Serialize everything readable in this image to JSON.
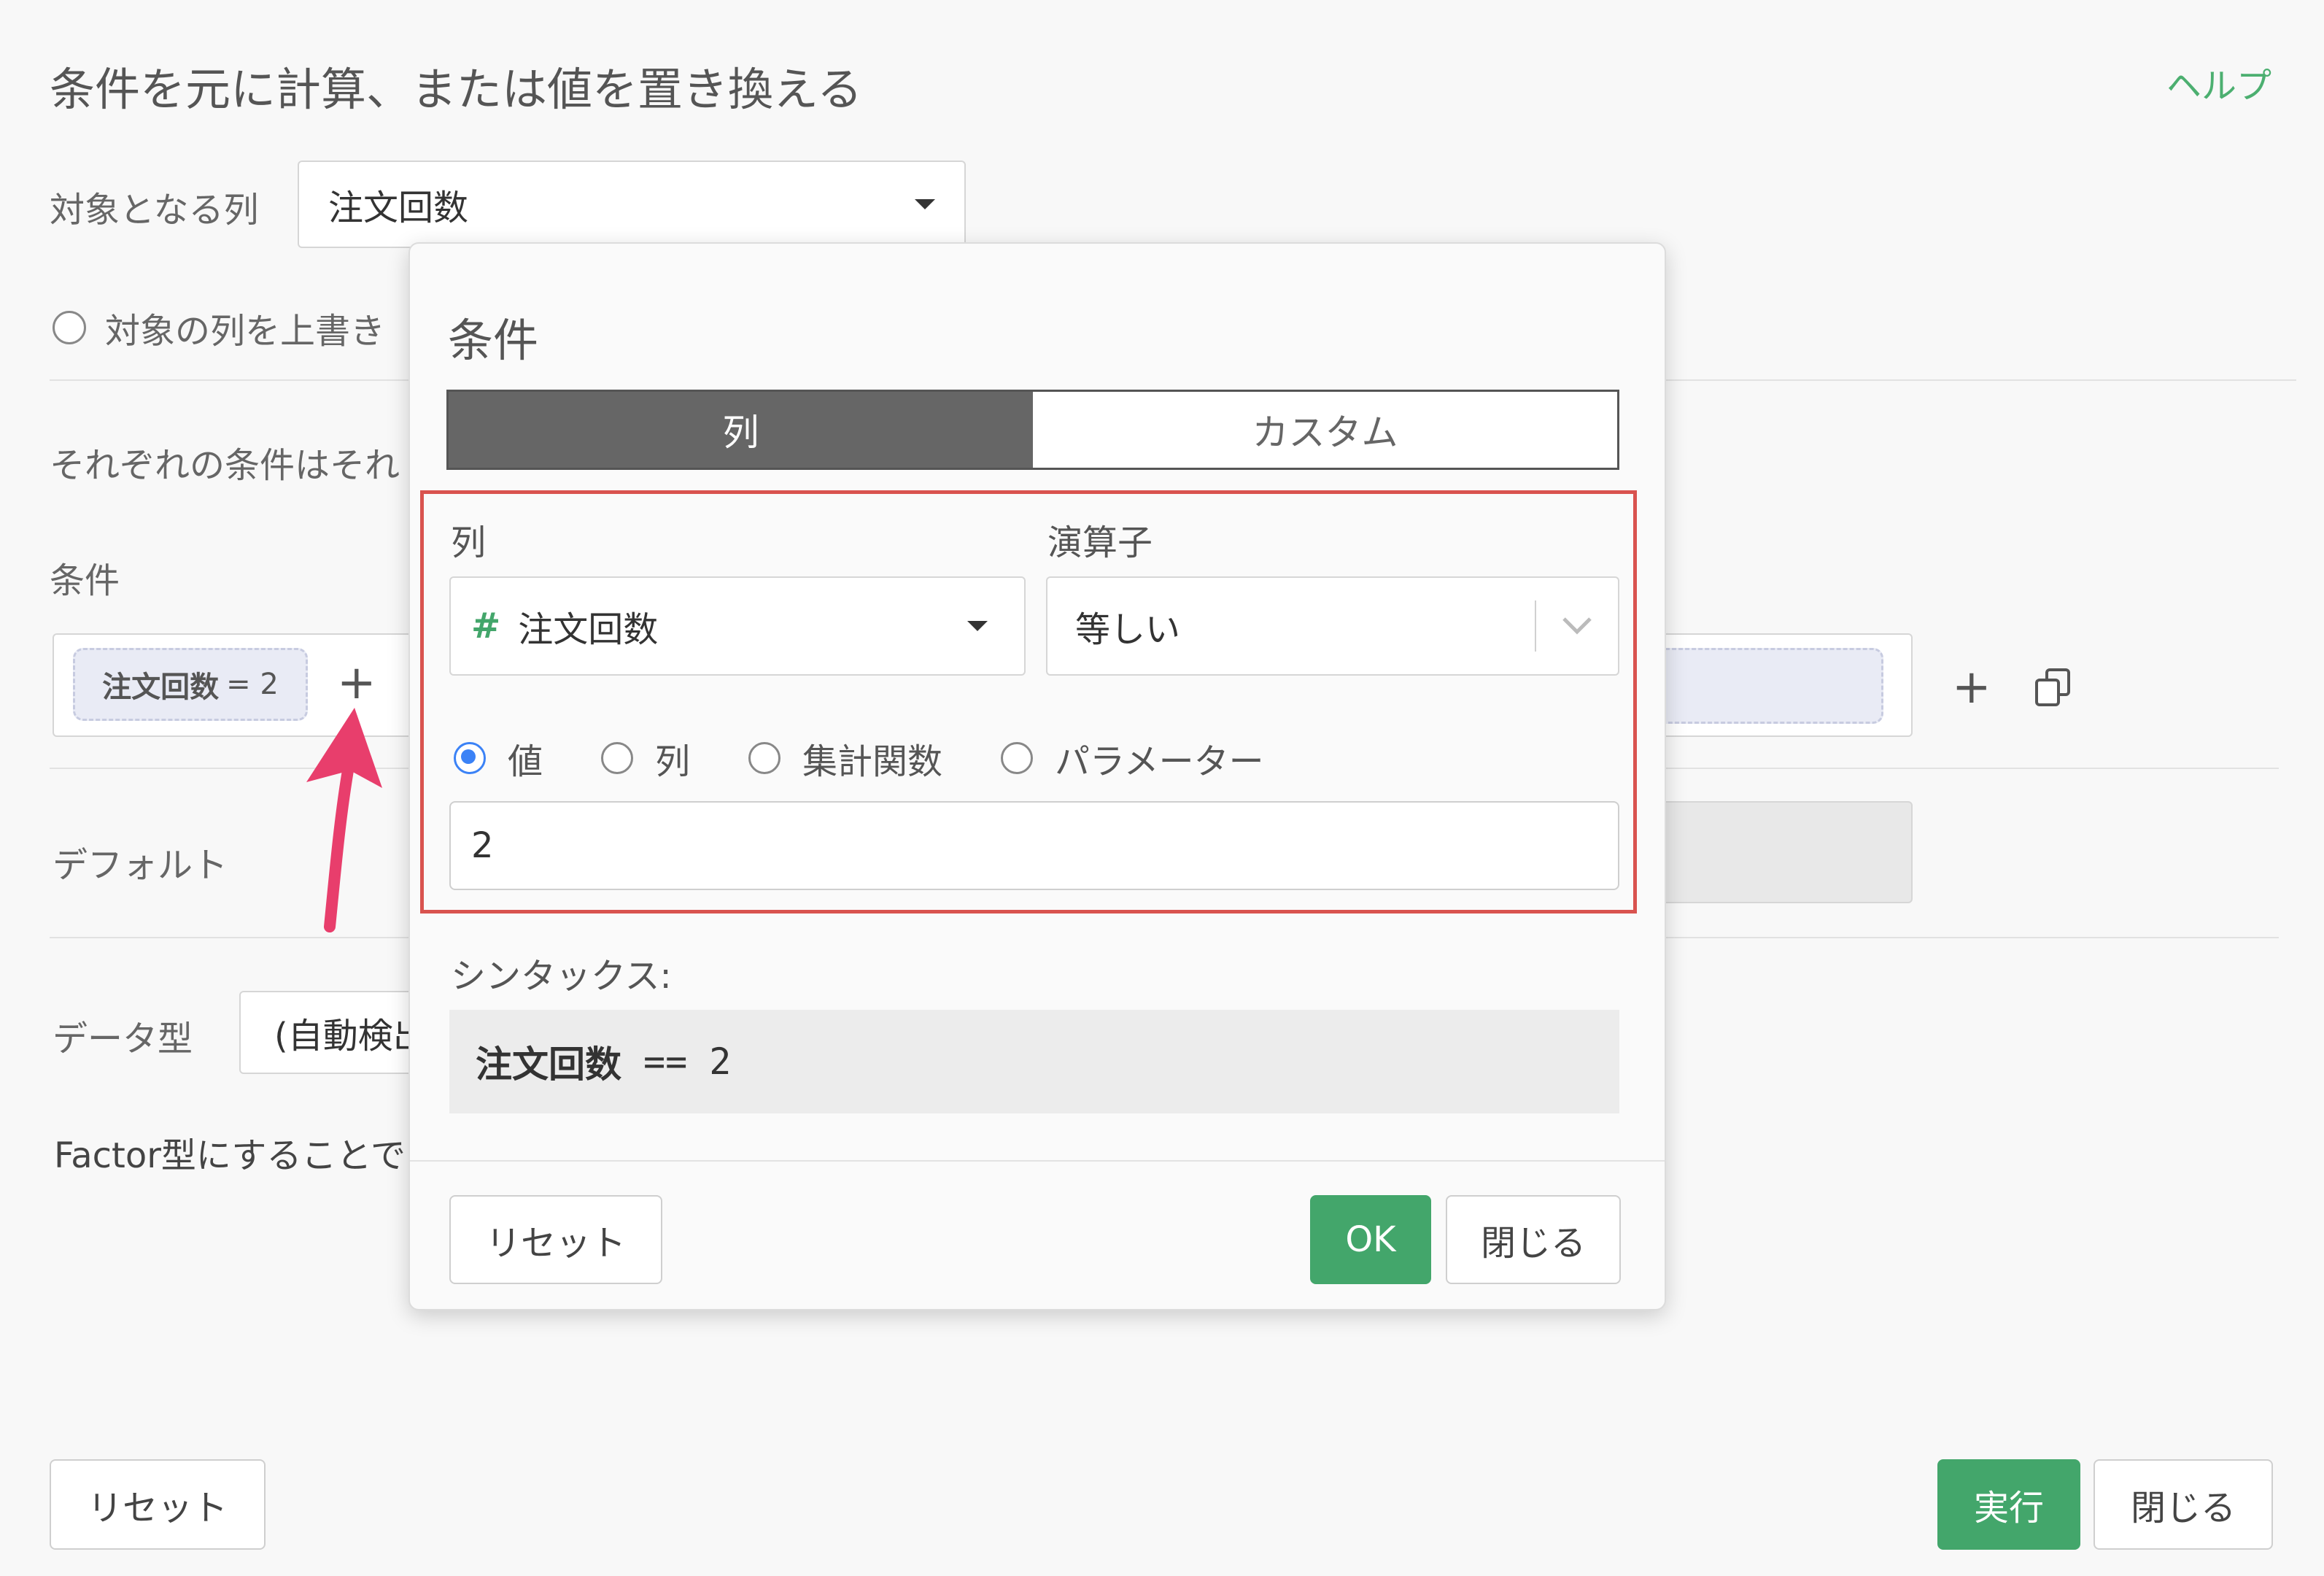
{
  "page": {
    "title": "条件を元に計算、または値を置き換える",
    "help_link": "ヘルプ"
  },
  "target_column": {
    "label": "対象となる列",
    "value": "注文回数"
  },
  "overwrite_option": {
    "label": "対象の列を上書き"
  },
  "description_partial": "それぞれの条件はそれ",
  "conditions": {
    "label": "条件",
    "tag_column": "注文回数",
    "tag_op_value": "= 2"
  },
  "default": {
    "label": "デフォルト"
  },
  "data_type": {
    "label": "データ型",
    "value_partial": "(自動検出"
  },
  "factor_note_partial": "Factor型にすることで",
  "footer": {
    "reset": "リセット",
    "run": "実行",
    "close": "閉じる"
  },
  "modal": {
    "title": "条件",
    "tabs": [
      {
        "label": "列",
        "active": true
      },
      {
        "label": "カスタム",
        "active": false
      }
    ],
    "column_label": "列",
    "column_icon": "#",
    "column_value": "注文回数",
    "operator_label": "演算子",
    "operator_value": "等しい",
    "value_types": [
      "値",
      "列",
      "集計関数",
      "パラメーター"
    ],
    "selected_value_type": "値",
    "value_input": "2",
    "syntax_label": "シンタックス:",
    "syntax_column": "注文回数",
    "syntax_rest": "==  2",
    "reset": "リセット",
    "ok": "OK",
    "close": "閉じる"
  },
  "colors": {
    "accent_green": "#43a66b",
    "highlight_red": "#d9534f",
    "arrow_pink": "#e83e6c",
    "radio_blue": "#3b82f6"
  }
}
